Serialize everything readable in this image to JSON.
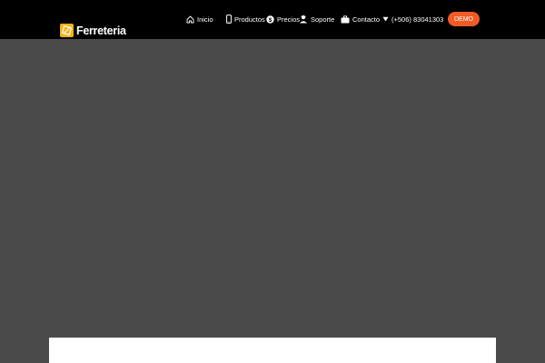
{
  "brand": {
    "name": "Ferreteria",
    "accent_color": "#f5b21b"
  },
  "nav": {
    "items": [
      {
        "label": "Inicio",
        "icon": "home-icon"
      },
      {
        "label": "Productos",
        "icon": "mobile-icon"
      },
      {
        "label": "Precios",
        "icon": "dollar-coin-icon"
      },
      {
        "label": "Soporte",
        "icon": "support-agent-icon"
      },
      {
        "label": "Contacto",
        "icon": "briefcase-icon"
      },
      {
        "label": "(+506) 83041303",
        "icon": "caret-down-icon"
      }
    ]
  },
  "demo": {
    "label": "DEMO",
    "color": "#f25b24"
  },
  "colors": {
    "header_bg": "#000000",
    "page_bg": "#4a4a4a",
    "card_bg": "#ffffff"
  }
}
